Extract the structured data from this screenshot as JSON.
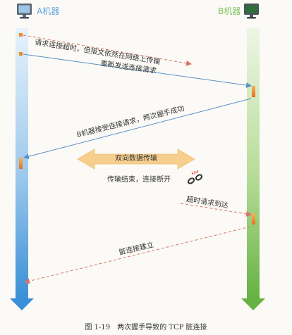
{
  "node_a": {
    "title": "A机器",
    "icon": "monitor-icon"
  },
  "node_b": {
    "title": "B机器",
    "icon": "monitor-icon"
  },
  "messages": [
    {
      "id": "m1",
      "label": "请求连接超时，但报文依然在网络上传输",
      "from": "A",
      "style": "dashed"
    },
    {
      "id": "m2",
      "label": "重新发送连接请求",
      "from": "A",
      "style": "solid"
    },
    {
      "id": "m3",
      "label": "B机器接受连接请求，两次握手成功",
      "from": "B",
      "style": "solid"
    },
    {
      "id": "m4",
      "label": "超时请求到达",
      "from": "A",
      "style": "dashed"
    },
    {
      "id": "m5",
      "label": "脏连接建立",
      "from": "B",
      "style": "dashed"
    }
  ],
  "transfer": {
    "label": "双向数据传输",
    "icon": "double-arrow-icon"
  },
  "transfer_end": {
    "label": "传输结束，连接断开",
    "icon": "broken-chain-icon"
  },
  "caption": "图 1-19　两次握手导致的 TCP 脏连接",
  "colors": {
    "lane_a": "#5fa6dd",
    "lane_b": "#82c15a",
    "arrow": "#5a8fc6",
    "arrow_dashed": "#d9726a",
    "marker": "#f08a24",
    "transfer": "#f6ce8e"
  }
}
